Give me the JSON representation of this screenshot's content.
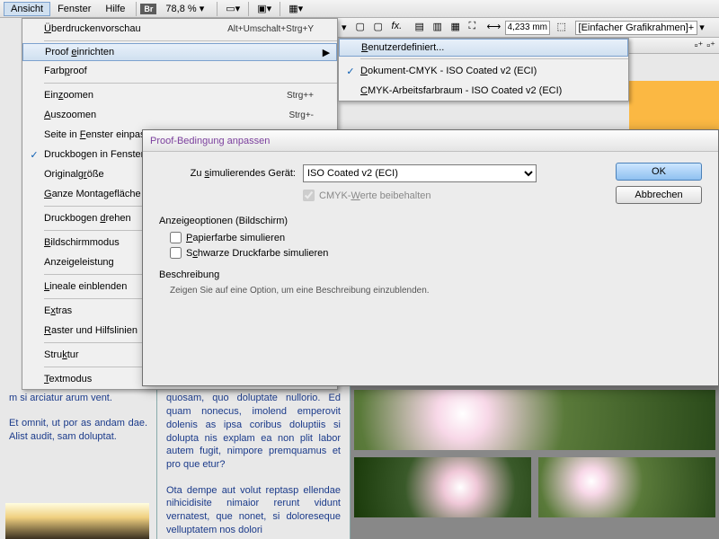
{
  "menubar": {
    "ansicht": "Ansicht",
    "fenster": "Fenster",
    "hilfe": "Hilfe",
    "br": "Br",
    "zoom": "78,8 %"
  },
  "toolbar2": {
    "measure": "4,233 mm",
    "frame_label": "[Einfacher Grafikrahmen]+"
  },
  "dropdown": {
    "items": [
      {
        "label": "Überdruckenvorschau",
        "shortcut": "Alt+Umschalt+Strg+Y",
        "u": 0
      },
      {
        "label": "Proof einrichten",
        "arrow": true,
        "hl": true,
        "u": 6
      },
      {
        "label": "Farbproof",
        "u": 4
      },
      {
        "label": "Einzoomen",
        "shortcut": "Strg++",
        "u": 3
      },
      {
        "label": "Auszoomen",
        "shortcut": "Strg+-",
        "u": 0
      },
      {
        "label": "Seite in Fenster einpassen",
        "u": 9
      },
      {
        "label": "Druckbogen in Fenster einpassen",
        "checked": true,
        "u": 21
      },
      {
        "label": "Originalgröße",
        "u": 9
      },
      {
        "label": "Ganze Montagefläche",
        "u": 0
      },
      {
        "label": "Druckbogen drehen",
        "u": 11
      },
      {
        "label": "Bildschirmmodus",
        "u": 0
      },
      {
        "label": "Anzeigeleistung"
      },
      {
        "label": "Lineale einblenden",
        "u": 0
      },
      {
        "label": "Extras",
        "u": 1
      },
      {
        "label": "Raster und Hilfslinien",
        "u": 0
      },
      {
        "label": "Struktur",
        "u": 4
      },
      {
        "label": "Textmodus",
        "u": 0
      }
    ],
    "separators_after": [
      0,
      2,
      8,
      9,
      11,
      12,
      14,
      15
    ]
  },
  "submenu": {
    "items": [
      {
        "label": "Benutzerdefiniert...",
        "hl": true,
        "u": 0
      },
      {
        "label": "Dokument-CMYK - ISO Coated v2 (ECI)",
        "checked": true,
        "u": 0
      },
      {
        "label": "CMYK-Arbeitsfarbraum - ISO Coated v2 (ECI)",
        "u": 0
      }
    ],
    "separators_after": [
      0
    ]
  },
  "dialog": {
    "title": "Proof-Bedingung anpassen",
    "device_label": "Zu simulierendes Gerät:",
    "device_value": "ISO Coated v2 (ECI)",
    "keep_cmyk": "CMYK-Werte beibehalten",
    "display_group": "Anzeigeoptionen (Bildschirm)",
    "paper": "Papierfarbe simulieren",
    "black": "Schwarze Druckfarbe simulieren",
    "desc_title": "Beschreibung",
    "desc_text": "Zeigen Sie auf eine Option, um eine Beschreibung einzublenden.",
    "ok": "OK",
    "cancel": "Abbrechen"
  },
  "content": {
    "col1a": "m si arciatur arum vent.",
    "col1b": "Et omnit, ut por as andam dae. Alist audit, sam doluptat.",
    "col2a": "quosam, quo doluptate nullorio. Ed quam nonecus, imolend emperovit dolenis as ipsa coribus doluptiis si dolupta nis explam ea non plit labor autem fugit, nimpore premquamus et pro que etur?",
    "col2b": "Ota dempe aut volut reptasp ellendae nihicidisite nimaior rerunt vidunt vernatest, que nonet, si doloreseque velluptatem nos dolori"
  }
}
